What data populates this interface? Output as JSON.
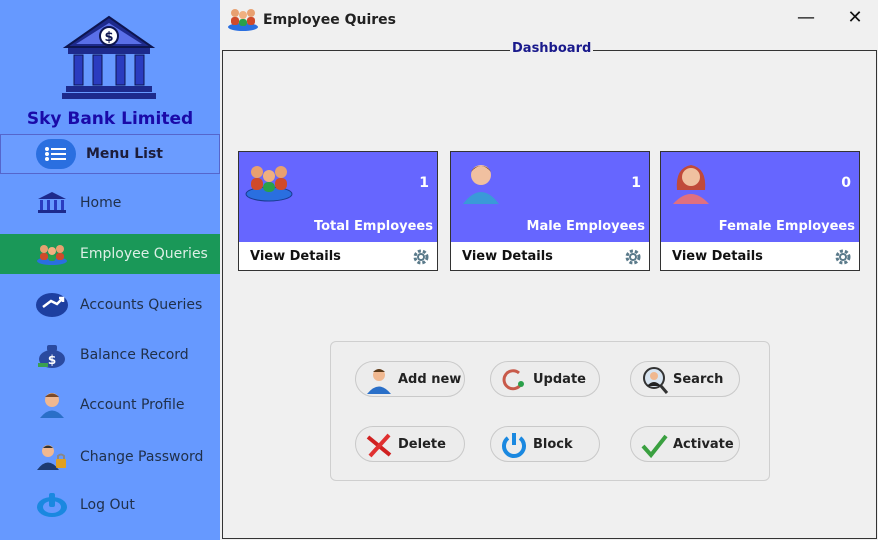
{
  "sidebar": {
    "bank_name": "Sky Bank Limited",
    "menu_label": "Menu List",
    "items": [
      {
        "label": "Home",
        "icon": "bank-icon"
      },
      {
        "label": "Employee Queries",
        "icon": "employees-icon",
        "active": true
      },
      {
        "label": "Accounts Queries",
        "icon": "accounts-icon"
      },
      {
        "label": "Balance Record",
        "icon": "money-bag-icon"
      },
      {
        "label": "Account Profile",
        "icon": "user-icon"
      },
      {
        "label": "Change Password",
        "icon": "user-lock-icon"
      },
      {
        "label": "Log Out",
        "icon": "power-icon"
      }
    ]
  },
  "window": {
    "title": "Employee Quires",
    "minimize": "—",
    "close": "✕"
  },
  "dashboard": {
    "legend": "Dashboard",
    "cards": [
      {
        "count": "1",
        "label": "Total Employees",
        "link": "View Details"
      },
      {
        "count": "1",
        "label": "Male Employees",
        "link": "View Details"
      },
      {
        "count": "0",
        "label": "Female Employees",
        "link": "View Details"
      }
    ]
  },
  "actions": {
    "add_new": "Add new",
    "update": "Update",
    "search": "Search",
    "delete": "Delete",
    "block": "Block",
    "activate": "Activate"
  },
  "colors": {
    "sidebar_bg": "#6699ff",
    "active_item": "#1a9858",
    "card_bg": "#6666ff",
    "bank_name": "#1a0aa8"
  }
}
